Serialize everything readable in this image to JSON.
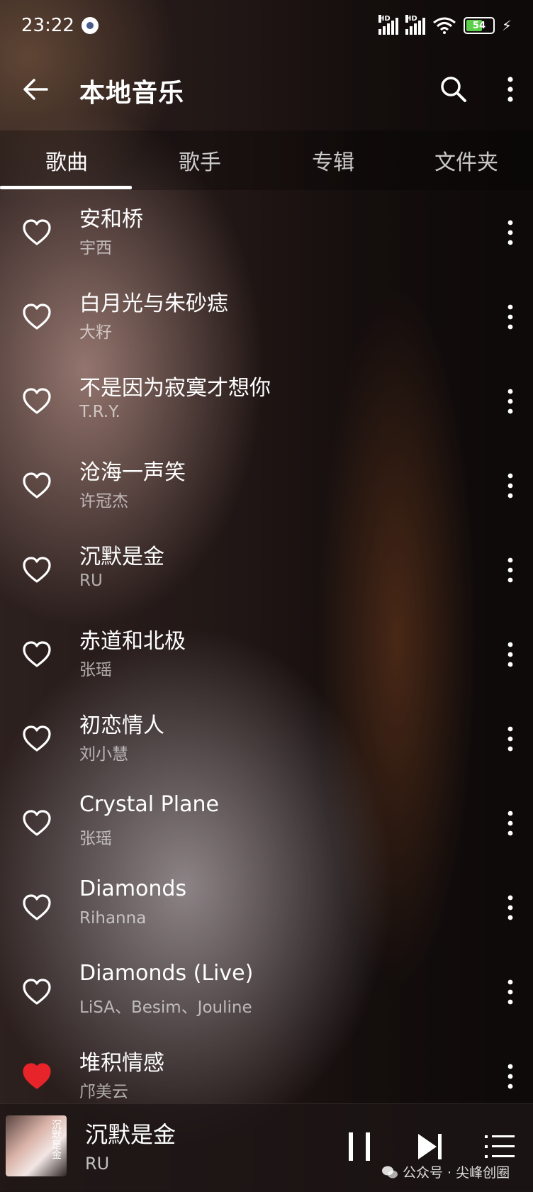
{
  "status": {
    "time": "23:22",
    "signal_label_1": "HD",
    "signal_label_2": "HD",
    "battery": "54"
  },
  "appbar": {
    "title": "本地音乐",
    "back_icon": "arrow-left-icon",
    "search_icon": "search-icon",
    "more_icon": "more-vertical-icon"
  },
  "tabs": [
    {
      "label": "歌曲",
      "active": true
    },
    {
      "label": "歌手",
      "active": false
    },
    {
      "label": "专辑",
      "active": false
    },
    {
      "label": "文件夹",
      "active": false
    }
  ],
  "songs": [
    {
      "title": "安和桥",
      "artist": "宇西",
      "liked": false
    },
    {
      "title": "白月光与朱砂痣",
      "artist": "大籽",
      "liked": false
    },
    {
      "title": "不是因为寂寞才想你",
      "artist": "T.R.Y.",
      "liked": false
    },
    {
      "title": "沧海一声笑",
      "artist": "许冠杰",
      "liked": false
    },
    {
      "title": "沉默是金",
      "artist": "RU",
      "liked": false
    },
    {
      "title": "赤道和北极",
      "artist": "张瑶",
      "liked": false
    },
    {
      "title": "初恋情人",
      "artist": "刘小慧",
      "liked": false
    },
    {
      "title": "Crystal Plane",
      "artist": "张瑶",
      "liked": false
    },
    {
      "title": "Diamonds",
      "artist": "Rihanna",
      "liked": false
    },
    {
      "title": "Diamonds (Live)",
      "artist": "LiSA、Besim、Jouline",
      "liked": false
    },
    {
      "title": "堆积情感",
      "artist": "邝美云",
      "liked": true
    }
  ],
  "player": {
    "title": "沉默是金",
    "artist": "RU",
    "cover_text": "沉默是金",
    "watermark": "公众号 · 尖峰创圈"
  },
  "colors": {
    "liked": "#e8242b",
    "battery_fill": "#5ad04a"
  }
}
